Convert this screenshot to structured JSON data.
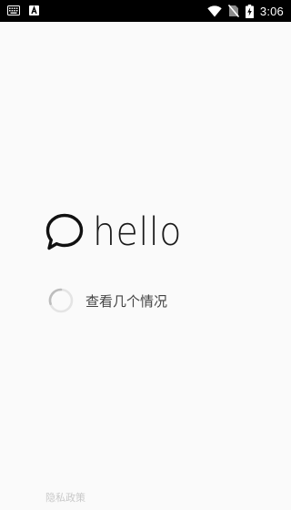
{
  "status_bar": {
    "time": "3:06",
    "left_icons": [
      "keyboard-icon",
      "app-a-icon"
    ],
    "right_icons": [
      "wifi-icon",
      "no-sim-icon",
      "battery-charging-icon"
    ]
  },
  "logo": {
    "text": "hello",
    "icon": "chat-bubble-icon"
  },
  "loading": {
    "text": "查看几个情况",
    "icon": "spinner-icon"
  },
  "footer": {
    "privacy_label": "隐私政策"
  }
}
